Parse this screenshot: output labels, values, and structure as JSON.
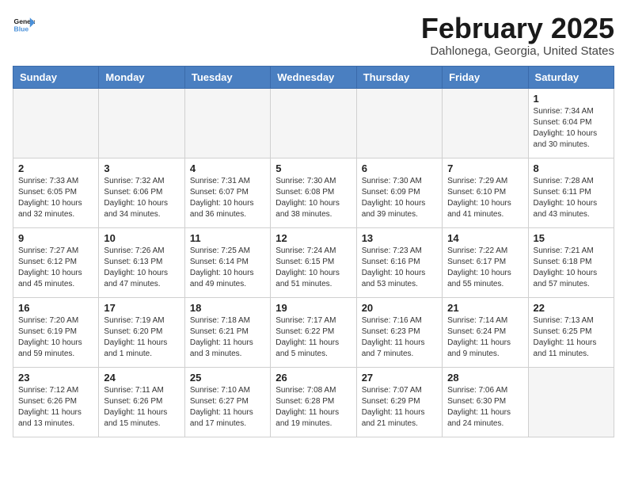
{
  "header": {
    "logo_line1": "General",
    "logo_line2": "Blue",
    "month": "February 2025",
    "location": "Dahlonega, Georgia, United States"
  },
  "weekdays": [
    "Sunday",
    "Monday",
    "Tuesday",
    "Wednesday",
    "Thursday",
    "Friday",
    "Saturday"
  ],
  "weeks": [
    [
      {
        "day": "",
        "info": ""
      },
      {
        "day": "",
        "info": ""
      },
      {
        "day": "",
        "info": ""
      },
      {
        "day": "",
        "info": ""
      },
      {
        "day": "",
        "info": ""
      },
      {
        "day": "",
        "info": ""
      },
      {
        "day": "1",
        "info": "Sunrise: 7:34 AM\nSunset: 6:04 PM\nDaylight: 10 hours and 30 minutes."
      }
    ],
    [
      {
        "day": "2",
        "info": "Sunrise: 7:33 AM\nSunset: 6:05 PM\nDaylight: 10 hours and 32 minutes."
      },
      {
        "day": "3",
        "info": "Sunrise: 7:32 AM\nSunset: 6:06 PM\nDaylight: 10 hours and 34 minutes."
      },
      {
        "day": "4",
        "info": "Sunrise: 7:31 AM\nSunset: 6:07 PM\nDaylight: 10 hours and 36 minutes."
      },
      {
        "day": "5",
        "info": "Sunrise: 7:30 AM\nSunset: 6:08 PM\nDaylight: 10 hours and 38 minutes."
      },
      {
        "day": "6",
        "info": "Sunrise: 7:30 AM\nSunset: 6:09 PM\nDaylight: 10 hours and 39 minutes."
      },
      {
        "day": "7",
        "info": "Sunrise: 7:29 AM\nSunset: 6:10 PM\nDaylight: 10 hours and 41 minutes."
      },
      {
        "day": "8",
        "info": "Sunrise: 7:28 AM\nSunset: 6:11 PM\nDaylight: 10 hours and 43 minutes."
      }
    ],
    [
      {
        "day": "9",
        "info": "Sunrise: 7:27 AM\nSunset: 6:12 PM\nDaylight: 10 hours and 45 minutes."
      },
      {
        "day": "10",
        "info": "Sunrise: 7:26 AM\nSunset: 6:13 PM\nDaylight: 10 hours and 47 minutes."
      },
      {
        "day": "11",
        "info": "Sunrise: 7:25 AM\nSunset: 6:14 PM\nDaylight: 10 hours and 49 minutes."
      },
      {
        "day": "12",
        "info": "Sunrise: 7:24 AM\nSunset: 6:15 PM\nDaylight: 10 hours and 51 minutes."
      },
      {
        "day": "13",
        "info": "Sunrise: 7:23 AM\nSunset: 6:16 PM\nDaylight: 10 hours and 53 minutes."
      },
      {
        "day": "14",
        "info": "Sunrise: 7:22 AM\nSunset: 6:17 PM\nDaylight: 10 hours and 55 minutes."
      },
      {
        "day": "15",
        "info": "Sunrise: 7:21 AM\nSunset: 6:18 PM\nDaylight: 10 hours and 57 minutes."
      }
    ],
    [
      {
        "day": "16",
        "info": "Sunrise: 7:20 AM\nSunset: 6:19 PM\nDaylight: 10 hours and 59 minutes."
      },
      {
        "day": "17",
        "info": "Sunrise: 7:19 AM\nSunset: 6:20 PM\nDaylight: 11 hours and 1 minute."
      },
      {
        "day": "18",
        "info": "Sunrise: 7:18 AM\nSunset: 6:21 PM\nDaylight: 11 hours and 3 minutes."
      },
      {
        "day": "19",
        "info": "Sunrise: 7:17 AM\nSunset: 6:22 PM\nDaylight: 11 hours and 5 minutes."
      },
      {
        "day": "20",
        "info": "Sunrise: 7:16 AM\nSunset: 6:23 PM\nDaylight: 11 hours and 7 minutes."
      },
      {
        "day": "21",
        "info": "Sunrise: 7:14 AM\nSunset: 6:24 PM\nDaylight: 11 hours and 9 minutes."
      },
      {
        "day": "22",
        "info": "Sunrise: 7:13 AM\nSunset: 6:25 PM\nDaylight: 11 hours and 11 minutes."
      }
    ],
    [
      {
        "day": "23",
        "info": "Sunrise: 7:12 AM\nSunset: 6:26 PM\nDaylight: 11 hours and 13 minutes."
      },
      {
        "day": "24",
        "info": "Sunrise: 7:11 AM\nSunset: 6:26 PM\nDaylight: 11 hours and 15 minutes."
      },
      {
        "day": "25",
        "info": "Sunrise: 7:10 AM\nSunset: 6:27 PM\nDaylight: 11 hours and 17 minutes."
      },
      {
        "day": "26",
        "info": "Sunrise: 7:08 AM\nSunset: 6:28 PM\nDaylight: 11 hours and 19 minutes."
      },
      {
        "day": "27",
        "info": "Sunrise: 7:07 AM\nSunset: 6:29 PM\nDaylight: 11 hours and 21 minutes."
      },
      {
        "day": "28",
        "info": "Sunrise: 7:06 AM\nSunset: 6:30 PM\nDaylight: 11 hours and 24 minutes."
      },
      {
        "day": "",
        "info": ""
      }
    ]
  ]
}
